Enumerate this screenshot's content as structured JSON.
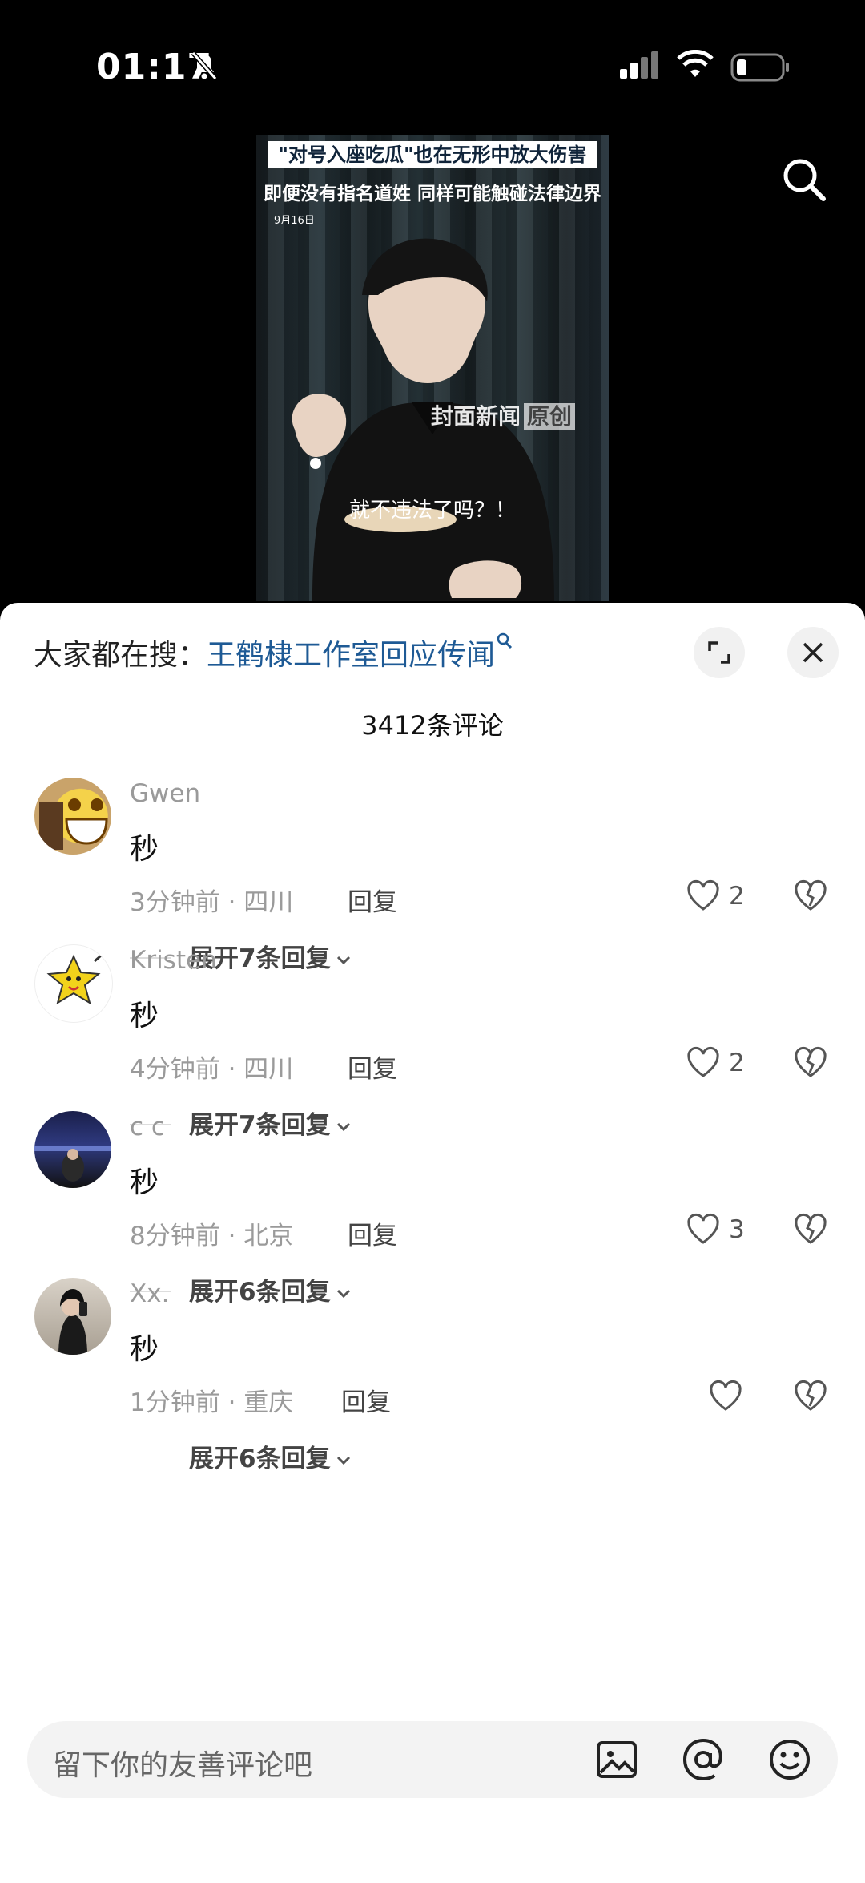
{
  "status_bar": {
    "time": "01:17"
  },
  "video": {
    "headline_1": "\"对号入座吃瓜\"也在无形中放大伤害",
    "headline_2": "即便没有指名道姓 同样可能触碰法律边界",
    "date": "9月16日",
    "watermark": "封面新闻",
    "watermark_tag": "原创",
    "subtitle": "就不违法了吗？！"
  },
  "sheet": {
    "hot_search_prefix": "大家都在搜：",
    "hot_search_term": "王鹤棣工作室回应传闻",
    "comment_count": "3412条评论"
  },
  "comments": [
    {
      "user": "Gwen",
      "text": "秒",
      "meta": "3分钟前 · 四川",
      "reply": "回复",
      "likes": "2",
      "expand": "展开7条回复"
    },
    {
      "user": "Kristen",
      "text": "秒",
      "meta": "4分钟前 · 四川",
      "reply": "回复",
      "likes": "2",
      "expand": "展开7条回复"
    },
    {
      "user": "c c",
      "text": "秒",
      "meta": "8分钟前 · 北京",
      "reply": "回复",
      "likes": "3",
      "expand": "展开6条回复"
    },
    {
      "user": "Xx.",
      "text": "秒",
      "meta": "1分钟前 · 重庆",
      "reply": "回复",
      "likes": "",
      "expand": "展开6条回复"
    }
  ],
  "input": {
    "placeholder": "留下你的友善评论吧"
  },
  "icons": [
    "bell-off-icon",
    "signal-icon",
    "wifi-icon",
    "battery-icon",
    "search-icon",
    "fullscreen-icon",
    "close-icon",
    "heart-icon",
    "broken-heart-icon",
    "chevron-down-icon",
    "image-icon",
    "at-icon",
    "emoji-icon"
  ]
}
